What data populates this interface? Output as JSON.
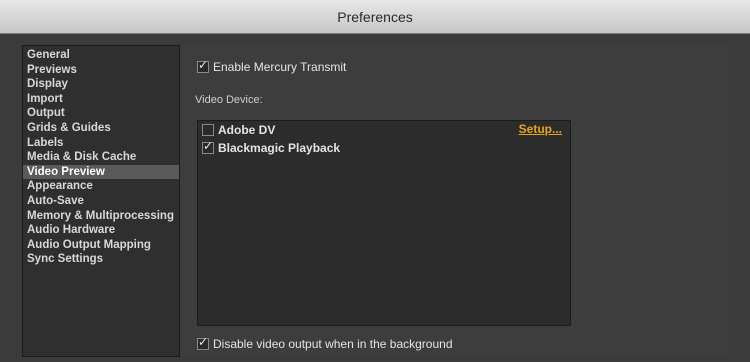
{
  "window": {
    "title": "Preferences"
  },
  "sidebar": {
    "items": [
      {
        "label": "General"
      },
      {
        "label": "Previews"
      },
      {
        "label": "Display"
      },
      {
        "label": "Import"
      },
      {
        "label": "Output"
      },
      {
        "label": "Grids & Guides"
      },
      {
        "label": "Labels"
      },
      {
        "label": "Media & Disk Cache"
      },
      {
        "label": "Video Preview",
        "selected": true
      },
      {
        "label": "Appearance"
      },
      {
        "label": "Auto-Save"
      },
      {
        "label": "Memory & Multiprocessing"
      },
      {
        "label": "Audio Hardware"
      },
      {
        "label": "Audio Output Mapping"
      },
      {
        "label": "Sync Settings"
      }
    ]
  },
  "video_preview": {
    "enable_mercury": {
      "label": "Enable Mercury Transmit",
      "checked": true
    },
    "video_device_label": "Video Device:",
    "devices": [
      {
        "name": "Adobe DV",
        "checked": false,
        "action": "Setup..."
      },
      {
        "name": "Blackmagic Playback",
        "checked": true
      }
    ],
    "disable_background": {
      "label": "Disable video output when in the background",
      "checked": true
    }
  },
  "colors": {
    "accent_link": "#e8a51c",
    "selected_item_bg": "#5a5a5a"
  },
  "icons": {
    "check": "checkmark-icon"
  }
}
